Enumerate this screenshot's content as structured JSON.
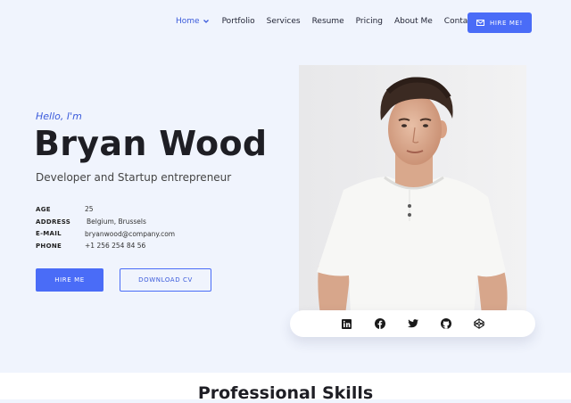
{
  "nav": {
    "items": [
      {
        "label": "Home",
        "active": true
      },
      {
        "label": "Portfolio"
      },
      {
        "label": "Services"
      },
      {
        "label": "Resume"
      },
      {
        "label": "Pricing"
      },
      {
        "label": "About Me"
      },
      {
        "label": "Contacts"
      }
    ],
    "hire_label": "HIRE ME!"
  },
  "hero": {
    "greeting": "Hello, I'm",
    "name": "Bryan Wood",
    "subtitle": "Developer and Startup entrepreneur",
    "info": [
      {
        "label": "AGE",
        "value": "25"
      },
      {
        "label": "ADDRESS",
        "value": "Belgium, Brussels"
      },
      {
        "label": "E-MAIL",
        "value": "bryanwood@company.com"
      },
      {
        "label": "PHONE",
        "value": "+1 256 254 84 56"
      }
    ],
    "hire_button": "HIRE ME",
    "download_button": "DOWNLOAD CV"
  },
  "social": [
    "linkedin-icon",
    "facebook-icon",
    "twitter-icon",
    "github-icon",
    "codepen-icon"
  ],
  "skills": {
    "title": "Professional Skills"
  },
  "colors": {
    "accent": "#4a6cf7",
    "background": "#f0f4fd"
  }
}
